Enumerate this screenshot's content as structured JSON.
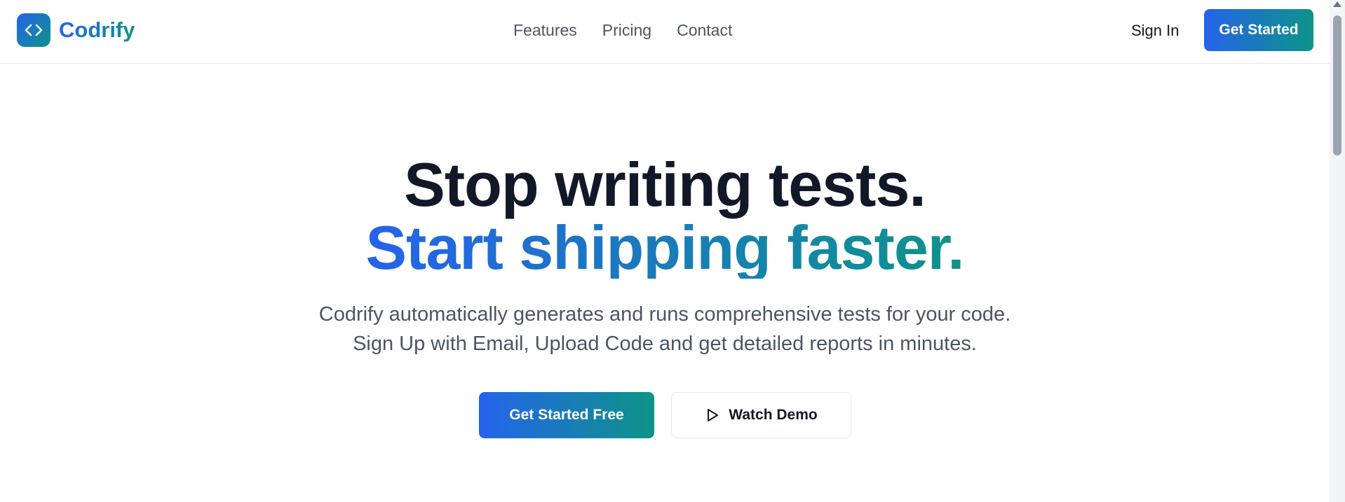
{
  "brand": {
    "name": "Codrify",
    "logo_icon": "code-brackets-icon",
    "gradient": [
      "#2563eb",
      "#0d9488"
    ]
  },
  "nav": {
    "items": [
      "Features",
      "Pricing",
      "Contact"
    ]
  },
  "header": {
    "sign_in": "Sign In",
    "cta": "Get Started"
  },
  "hero": {
    "title_line1": "Stop writing tests.",
    "title_line2": "Start shipping faster.",
    "subtitle": "Codrify automatically generates and runs comprehensive tests for your code. Sign Up with Email, Upload Code and get detailed reports in minutes.",
    "primary_cta": "Get Started Free",
    "secondary_cta": "Watch Demo",
    "secondary_icon": "play-icon"
  }
}
